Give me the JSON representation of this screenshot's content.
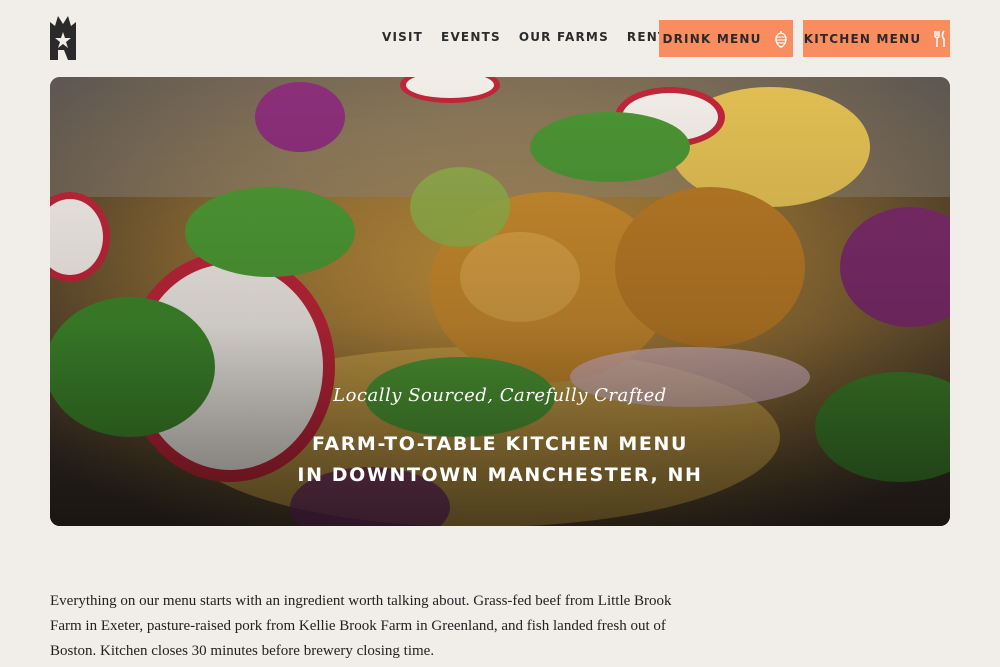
{
  "nav": {
    "items": [
      {
        "label": "VISIT"
      },
      {
        "label": "EVENTS"
      },
      {
        "label": "OUR FARMS"
      },
      {
        "label": "RENTALS"
      }
    ]
  },
  "buttons": {
    "drink_label": "DRINK MENU",
    "drink_icon": "hops-icon",
    "kitchen_label": "KITCHEN MENU",
    "kitchen_icon": "fork-knife-icon",
    "accent_color": "#f98d5f"
  },
  "hero": {
    "tagline": "Locally Sourced, Carefully Crafted",
    "headline_line1": "FARM-TO-TABLE KITCHEN MENU",
    "headline_line2": "IN DOWNTOWN MANCHESTER, NH"
  },
  "intro": {
    "text": "Everything on our menu starts with an ingredient worth talking about. Grass-fed beef from Little Brook Farm in Exeter, pasture-raised pork from Kellie Brook Farm in Greenland, and fish landed fresh out of Boston. Kitchen closes 30 minutes before brewery closing time."
  },
  "colors": {
    "background": "#f1eeea",
    "text": "#222222"
  }
}
